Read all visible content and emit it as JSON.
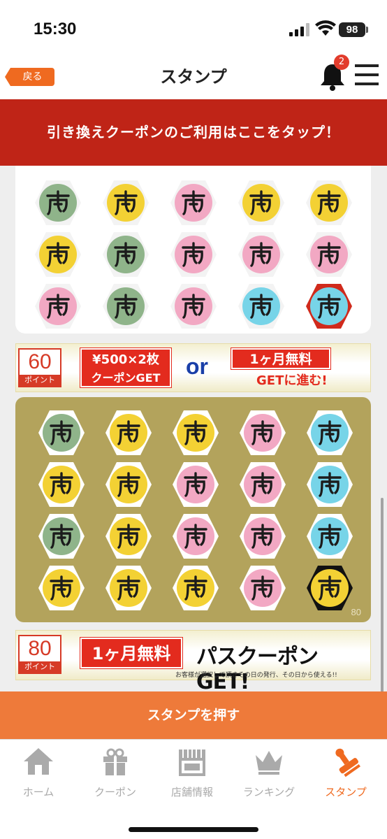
{
  "status": {
    "time": "15:30",
    "battery": "98"
  },
  "nav": {
    "back_label": "戻る",
    "title": "スタンプ",
    "notification_count": "2"
  },
  "coupon_banner": "引き換えクーポンのご利用はここをタップ！",
  "card1": {
    "stamps": [
      "green",
      "yellow",
      "pink",
      "yellow",
      "yellow",
      "yellow",
      "green",
      "pink",
      "pink",
      "pink",
      "pink",
      "green",
      "pink",
      "cyan",
      "cyan-red-hex"
    ]
  },
  "promo60": {
    "points": "60",
    "points_label": "ポイント",
    "line1": "¥500×2枚",
    "line2": "クーポンGET",
    "or": "or",
    "line3": "1ヶ月無料",
    "line4": "GETに進む!"
  },
  "card2": {
    "number": "80",
    "stamps": [
      "green",
      "yellow",
      "yellow",
      "pink",
      "cyan",
      "yellow",
      "yellow",
      "pink",
      "pink",
      "cyan",
      "green",
      "yellow",
      "pink",
      "pink",
      "cyan",
      "yellow",
      "yellow",
      "yellow",
      "pink",
      "yellow-black-hex"
    ]
  },
  "promo80": {
    "points": "80",
    "points_label": "ポイント",
    "red": "1ヶ月無料",
    "black": "パスクーポンGET!",
    "note": "お客様が選択して頂きその日の発行、その日から使える!!"
  },
  "stamp_button": "スタンプを押す",
  "tabs": [
    {
      "label": "ホーム",
      "icon": "home-icon"
    },
    {
      "label": "クーポン",
      "icon": "gift-icon"
    },
    {
      "label": "店舗情報",
      "icon": "store-icon"
    },
    {
      "label": "ランキング",
      "icon": "crown-icon"
    },
    {
      "label": "スタンプ",
      "icon": "stamp-icon",
      "active": true
    }
  ],
  "colors": {
    "accent": "#ef6a20",
    "banner_red": "#bf2417",
    "gold_card": "#b3a35c"
  }
}
